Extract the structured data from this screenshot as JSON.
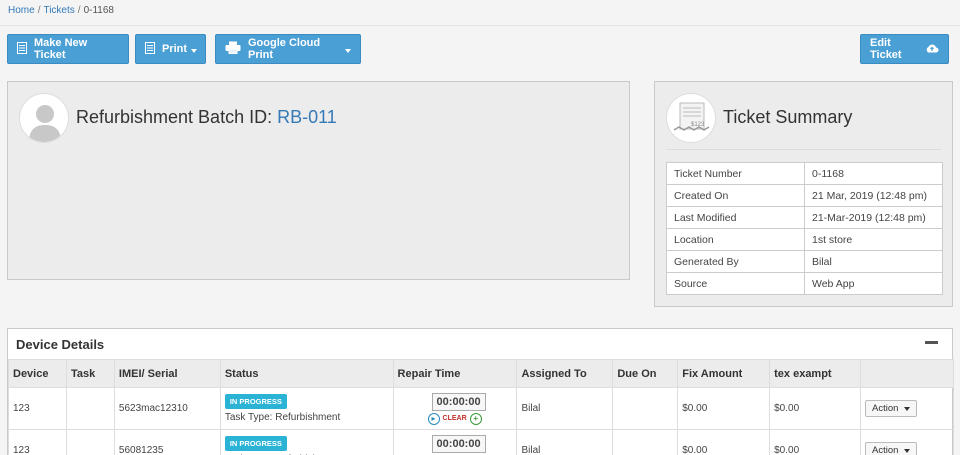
{
  "breadcrumb": {
    "home": "Home",
    "tickets": "Tickets",
    "current": "0-1168"
  },
  "toolbar": {
    "make_new": "Make New Ticket",
    "print": "Print",
    "cloud_print": "Google Cloud Print",
    "edit": "Edit Ticket"
  },
  "batch": {
    "label": "Refurbishment Batch ID:",
    "id": "RB-011"
  },
  "summary": {
    "icon_text": "$123",
    "title": "Ticket Summary",
    "rows": [
      {
        "label": "Ticket Number",
        "value": "0-1168"
      },
      {
        "label": "Created On",
        "value": "21 Mar, 2019 (12:48 pm)"
      },
      {
        "label": "Last Modified",
        "value": "21-Mar-2019 (12:48 pm)"
      },
      {
        "label": "Location",
        "value": "1st store"
      },
      {
        "label": "Generated By",
        "value": "Bilal"
      },
      {
        "label": "Source",
        "value": "Web App"
      }
    ]
  },
  "device": {
    "title": "Device Details",
    "headers": [
      "Device",
      "Task",
      "IMEI/ Serial",
      "Status",
      "Repair Time",
      "Assigned To",
      "Due On",
      "Fix Amount",
      "tex exampt",
      ""
    ],
    "rows": [
      {
        "device": "123",
        "task": "",
        "imei": "5623mac12310",
        "status": "IN PROGRESS",
        "task_type": "Task Type: Refurbishment",
        "timer": "00:00:00",
        "clear": "CLEAR",
        "assigned": "Bilal",
        "due": "",
        "fix": "$0.00",
        "tex": "$0.00",
        "action": "Action"
      },
      {
        "device": "123",
        "task": "",
        "imei": "56081235",
        "status": "IN PROGRESS",
        "task_type": "Task Type: Refurbishment",
        "timer": "00:00:00",
        "clear": "CLEAR",
        "assigned": "Bilal",
        "due": "",
        "fix": "$0.00",
        "tex": "$0.00",
        "action": "Action"
      }
    ]
  },
  "colors": {
    "primary": "#4a9fd5",
    "link": "#337ab7",
    "badge": "#2bb3d6"
  }
}
